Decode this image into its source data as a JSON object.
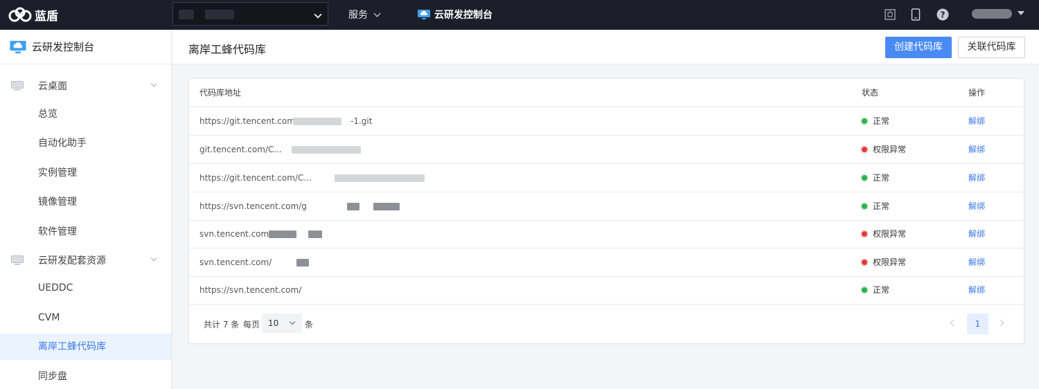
{
  "topbar": {
    "brand_name": "蓝盾",
    "services_label": "服务",
    "console_label": "云研发控制台"
  },
  "sidebar": {
    "title": "云研发控制台",
    "groups": [
      {
        "label": "云桌面",
        "items": [
          "总览",
          "自动化助手",
          "实例管理",
          "镜像管理",
          "软件管理"
        ]
      },
      {
        "label": "云研发配套资源",
        "items": [
          "UEDDC",
          "CVM",
          "离岸工蜂代码库",
          "同步盘"
        ]
      }
    ],
    "active_item": "离岸工蜂代码库"
  },
  "main": {
    "title": "离岸工蜂代码库",
    "create_button": "创建代码库",
    "link_button": "关联代码库"
  },
  "table": {
    "headers": {
      "address": "代码库地址",
      "status": "状态",
      "action": "操作"
    },
    "rows": [
      {
        "address": "https://git.tencent.com/",
        "address_tail": "-1.git",
        "status": "正常",
        "status_type": "ok",
        "action": "解绑"
      },
      {
        "address": "git.tencent.com/C...",
        "address_tail": "",
        "status": "权限异常",
        "status_type": "error",
        "action": "解绑"
      },
      {
        "address": "https://git.tencent.com/C...",
        "address_tail": "",
        "status": "正常",
        "status_type": "ok",
        "action": "解绑"
      },
      {
        "address": "https://svn.tencent.com/g",
        "address_tail": "",
        "status": "正常",
        "status_type": "ok",
        "action": "解绑"
      },
      {
        "address": "svn.tencent.com/",
        "address_tail": "",
        "status": "权限异常",
        "status_type": "error",
        "action": "解绑"
      },
      {
        "address": "svn.tencent.com/",
        "address_tail": "",
        "status": "权限异常",
        "status_type": "error",
        "action": "解绑"
      },
      {
        "address": "https://svn.tencent.com/",
        "address_tail": "",
        "status": "正常",
        "status_type": "ok",
        "action": "解绑"
      }
    ]
  },
  "pagination": {
    "total_text": "共计 7 条",
    "per_page_label": "每页",
    "page_size": "10",
    "unit": "条",
    "current_page": "1"
  },
  "colors": {
    "topbar_bg": "#1c1f2a",
    "primary": "#4a8af4",
    "link": "#3b7ae8",
    "status_ok": "#2fb04a",
    "status_error": "#e53a3a"
  }
}
